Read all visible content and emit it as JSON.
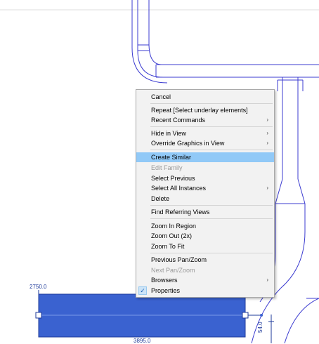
{
  "dimensions": {
    "top_left": "2750.0",
    "bottom": "3895.0",
    "right_vertical": "54.0"
  },
  "colors": {
    "linework": "#3b3bd0",
    "selection_fill": "#3a62d0",
    "highlight": "#91c9f7"
  },
  "menu": {
    "items": [
      {
        "label": "Cancel"
      },
      {
        "label": "Repeat [Select underlay elements]"
      },
      {
        "label": "Recent Commands",
        "submenu": true
      },
      {
        "label": "Hide in View",
        "submenu": true
      },
      {
        "label": "Override Graphics in View",
        "submenu": true
      },
      {
        "label": "Create Similar",
        "highlighted": true
      },
      {
        "label": "Edit Family",
        "disabled": true
      },
      {
        "label": "Select Previous"
      },
      {
        "label": "Select All Instances",
        "submenu": true
      },
      {
        "label": "Delete"
      },
      {
        "label": "Find Referring Views"
      },
      {
        "label": "Zoom In Region"
      },
      {
        "label": "Zoom Out (2x)"
      },
      {
        "label": "Zoom To Fit"
      },
      {
        "label": "Previous Pan/Zoom"
      },
      {
        "label": "Next Pan/Zoom",
        "disabled": true
      },
      {
        "label": "Browsers",
        "submenu": true
      },
      {
        "label": "Properties",
        "checked": true
      }
    ],
    "submenu_arrow": "›",
    "check_mark": "✓"
  }
}
